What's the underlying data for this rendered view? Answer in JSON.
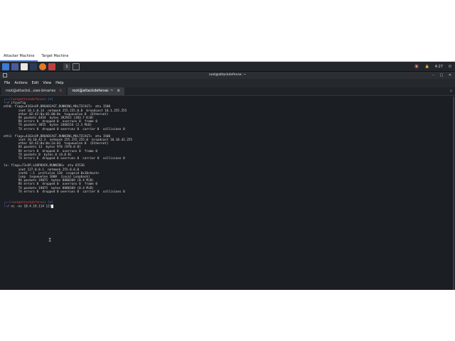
{
  "machine_tabs": [
    {
      "label": "Attacker Machine"
    },
    {
      "label": "Target Machine"
    }
  ],
  "taskbar": {
    "workspace": "1",
    "clock": "4:27",
    "colors": {
      "kali": "#3a7bd5",
      "app1": "#4a5a9a",
      "app2": "#e8e8e8",
      "app3": "#c04040"
    }
  },
  "window": {
    "title": "root@attackdefense: ~"
  },
  "menu": [
    "File",
    "Actions",
    "Edit",
    "View",
    "Help"
  ],
  "tabs": [
    {
      "label": "root@attackd...ows-binaries",
      "active": false
    },
    {
      "label": "root@attackdefense: ~",
      "active": true
    }
  ],
  "terminal": {
    "prompt_user": "root@attackdefense",
    "prompt_dir": "~",
    "command1": "ifconfig",
    "output": [
      "eth0: flags=4163<UP,BROADCAST,RUNNING,MULTICAST>  mtu 1500",
      "        inet 10.1.0.14  netmask 255.255.0.0  broadcast 10.1.255.255",
      "        ether 02:42:0a:01:00:0e  txqueuelen 0  (Ethernet)",
      "        RX packets 4454  bytes 392915 (383.7 KiB)",
      "        RX errors 0  dropped 0  overruns 0  frame 0",
      "        TX packets 3855  bytes 2468154 (2.3 MiB)",
      "        TX errors 0  dropped 0 overruns 0  carrier 0  collisions 0",
      "",
      "eth1: flags=4163<UP,BROADCAST,RUNNING,MULTICAST>  mtu 1500",
      "        inet 10.10.42.3  netmask 255.255.255.0  broadcast 10.10.42.255",
      "        ether 02:42:0a:0a:2a:03  txqueuelen 0  (Ethernet)",
      "        RX packets 13  bytes 978 (978.0 B)",
      "        RX errors 0  dropped 0  overruns 0  frame 0",
      "        TX packets 0  bytes 0 (0.0 B)",
      "        TX errors 0  dropped 0 overruns 0  carrier 0  collisions 0",
      "",
      "lo: flags=73<UP,LOOPBACK,RUNNING>  mtu 65536",
      "        inet 127.0.0.1  netmask 255.0.0.0",
      "        inet6 ::1  prefixlen 128  scopeid 0x10<host>",
      "        loop  txqueuelen 1000  (Local Loopback)",
      "        RX packets 19075  bytes 8880369 (8.4 MiB)",
      "        RX errors 0  dropped 0  overruns 0  frame 0",
      "        TX packets 19075  bytes 8880369 (8.4 MiB)",
      "        TX errors 0  dropped 0 overruns 0  carrier 0  collisions 0"
    ],
    "command2": "nc -nv 10.4.19.114 123"
  }
}
